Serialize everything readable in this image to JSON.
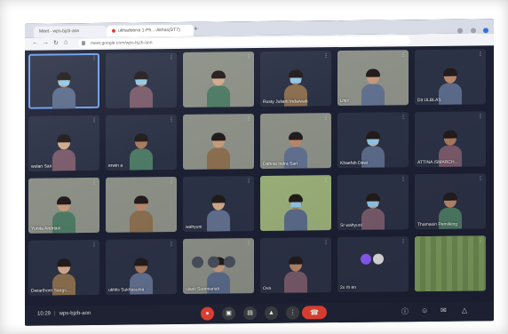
{
  "browser": {
    "tabs": [
      "Meet - wps-bjzb-aon",
      "ukhadoerra 1-Ph...-Akhas(DT7)"
    ],
    "url": "meet.google.com/wps-bjzb-aon"
  },
  "participants": [
    {
      "name": "",
      "mask": true,
      "active": true,
      "theme": "dark"
    },
    {
      "name": "",
      "mask": true,
      "active": false,
      "theme": "dark"
    },
    {
      "name": "",
      "mask": false,
      "active": false,
      "theme": "bright"
    },
    {
      "name": "Rusty Juliarti Indarwah",
      "mask": true,
      "active": false,
      "theme": "dark"
    },
    {
      "name": "UNY",
      "mask": false,
      "active": false,
      "theme": "bright"
    },
    {
      "name": "Dit ULBLAS",
      "mask": false,
      "active": false,
      "theme": "dark"
    },
    {
      "name": "wulan Sari",
      "mask": false,
      "active": false,
      "theme": "dark"
    },
    {
      "name": "erwin a",
      "mask": false,
      "active": false,
      "theme": "dark"
    },
    {
      "name": "",
      "mask": false,
      "active": false,
      "theme": "bright"
    },
    {
      "name": "Dahnia Indra Sari",
      "mask": false,
      "active": false,
      "theme": "bright"
    },
    {
      "name": "Khaefah Dewi",
      "mask": true,
      "active": false,
      "theme": "dark"
    },
    {
      "name": "ATTINA ISMARCH...",
      "mask": false,
      "active": false,
      "theme": "dark"
    },
    {
      "name": "Yunita Andriani",
      "mask": false,
      "active": false,
      "theme": "bright"
    },
    {
      "name": "",
      "mask": false,
      "active": false,
      "theme": "bright"
    },
    {
      "name": "wahyuni",
      "mask": false,
      "active": false,
      "theme": "dark"
    },
    {
      "name": "",
      "mask": true,
      "active": false,
      "theme": "green"
    },
    {
      "name": "Sr wahyuni",
      "mask": true,
      "active": false,
      "theme": "dark"
    },
    {
      "name": "Thamasin Pemilking",
      "mask": false,
      "active": false,
      "theme": "dark"
    },
    {
      "name": "Dwiarthorn Sangs...",
      "mask": false,
      "active": false,
      "theme": "dark"
    },
    {
      "name": "ukhlis Sukhasunia",
      "mask": false,
      "active": false,
      "theme": "dark"
    },
    {
      "name": "ulasti Suomianah",
      "mask": false,
      "active": false,
      "theme": "bright",
      "controls": true
    },
    {
      "name": "Ova",
      "mask": false,
      "active": false,
      "theme": "dark"
    },
    {
      "name": "2x rh en",
      "mask": false,
      "active": false,
      "theme": "dark",
      "avatars": true
    },
    {
      "name": "",
      "mask": false,
      "active": false,
      "theme": "green",
      "group": true
    }
  ],
  "meeting": {
    "time": "10:29",
    "code": "wps-bjzb-aon"
  },
  "icons": {
    "mic": "mic-off-icon",
    "camera": "camera-icon",
    "present": "present-icon",
    "more": "more-vert-icon",
    "end": "end-call-icon",
    "info": "info-icon",
    "people": "people-icon",
    "chat": "chat-icon",
    "activities": "activities-icon"
  }
}
